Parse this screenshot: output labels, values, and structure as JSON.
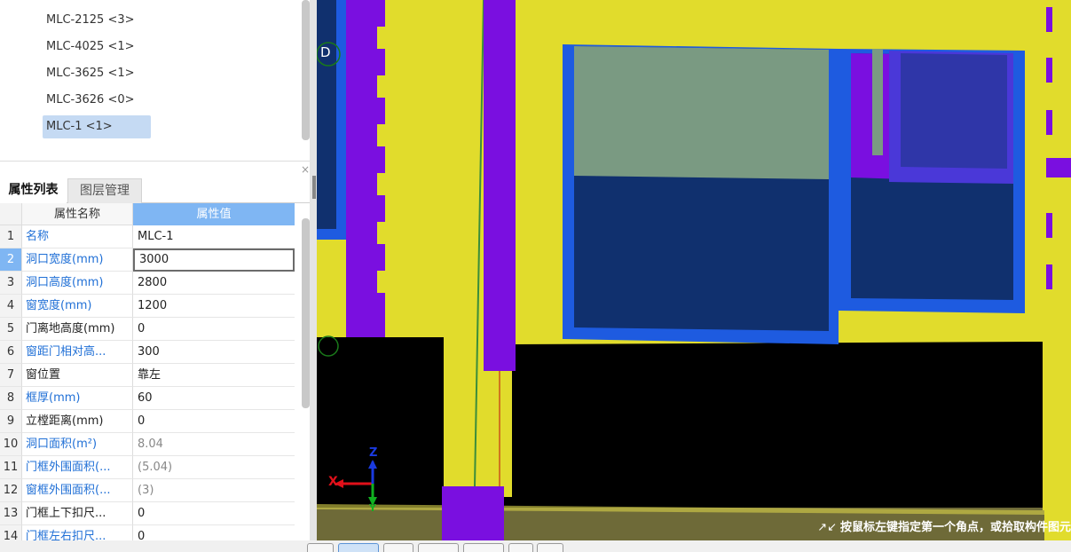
{
  "component_list": {
    "items": [
      {
        "label": "MLC-2125 <3>"
      },
      {
        "label": "MLC-4025 <1>"
      },
      {
        "label": "MLC-3625 <1>"
      },
      {
        "label": "MLC-3626 <0>"
      },
      {
        "label": "MLC-1 <1>",
        "selected": true
      }
    ]
  },
  "panel": {
    "close_glyph": "×",
    "tabs": [
      {
        "label": "属性列表",
        "active": true
      },
      {
        "label": "图层管理",
        "active": false
      }
    ]
  },
  "property_table": {
    "header_name": "属性名称",
    "header_value": "属性值",
    "rows": [
      {
        "index": "1",
        "name": "名称",
        "value": "MLC-1",
        "name_color": "blue"
      },
      {
        "index": "2",
        "name": "洞口宽度(mm)",
        "value": "3000",
        "name_color": "blue",
        "active": true
      },
      {
        "index": "3",
        "name": "洞口高度(mm)",
        "value": "2800",
        "name_color": "blue"
      },
      {
        "index": "4",
        "name": "窗宽度(mm)",
        "value": "1200",
        "name_color": "blue"
      },
      {
        "index": "5",
        "name": "门离地高度(mm)",
        "value": "0",
        "name_color": "dark"
      },
      {
        "index": "6",
        "name": "窗距门相对高...",
        "value": "300",
        "name_color": "blue"
      },
      {
        "index": "7",
        "name": "窗位置",
        "value": "靠左",
        "name_color": "dark"
      },
      {
        "index": "8",
        "name": "框厚(mm)",
        "value": "60",
        "name_color": "blue"
      },
      {
        "index": "9",
        "name": "立樘距离(mm)",
        "value": "0",
        "name_color": "dark"
      },
      {
        "index": "10",
        "name": "洞口面积(m²)",
        "value": "8.04",
        "name_color": "blue",
        "value_gray": true
      },
      {
        "index": "11",
        "name": "门框外围面积(...",
        "value": "(5.04)",
        "name_color": "blue",
        "value_gray": true
      },
      {
        "index": "12",
        "name": "窗框外围面积(...",
        "value": "(3)",
        "name_color": "blue",
        "value_gray": true
      },
      {
        "index": "13",
        "name": "门框上下扣尺...",
        "value": "0",
        "name_color": "dark"
      },
      {
        "index": "14",
        "name": "门框左右扣尺...",
        "value": "0",
        "name_color": "blue"
      }
    ]
  },
  "viewport": {
    "axis_label_d": "D",
    "axis_x": "X",
    "axis_z": "Z",
    "axis_y": "Y",
    "status_message": "按鼠标左键指定第一个角点，或拾取构件图元",
    "status_icon": "corner-arrow-icon",
    "colors": {
      "wall_yellow": "#e1dc2c",
      "purple": "#7a0fe0",
      "blue": "#1e5be0",
      "navy": "#10306e",
      "glass_green": "#7a9a82",
      "floor_black": "#000000",
      "ground_olive": "#6e6a38"
    }
  }
}
